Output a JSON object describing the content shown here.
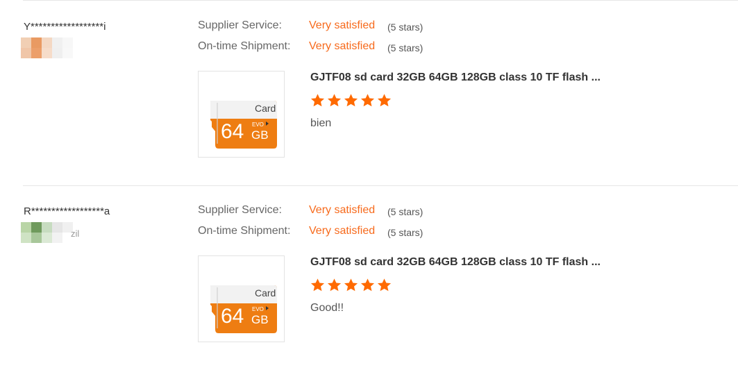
{
  "reviews": [
    {
      "buyer": "Y******************i",
      "country": "",
      "supplier_service_label": "Supplier Service:",
      "supplier_service_value": "Very satisfied",
      "supplier_service_stars": "(5 stars)",
      "shipment_label": "On-time Shipment:",
      "shipment_value": "Very satisfied",
      "shipment_stars": "(5 stars)",
      "product_title": "GJTF08 sd card 32GB 64GB 128GB class 10 TF flash ...",
      "rating": 5,
      "comment": "bien",
      "thumb": {
        "card_text": "Card",
        "capacity": "64",
        "unit": "GB",
        "brand": "EVO"
      }
    },
    {
      "buyer": "R******************a",
      "country": "zil",
      "supplier_service_label": "Supplier Service:",
      "supplier_service_value": "Very satisfied",
      "supplier_service_stars": "(5 stars)",
      "shipment_label": "On-time Shipment:",
      "shipment_value": "Very satisfied",
      "shipment_stars": "(5 stars)",
      "product_title": "GJTF08 sd card 32GB 64GB 128GB class 10 TF flash ...",
      "rating": 5,
      "comment": "Good!!",
      "thumb": {
        "card_text": "Card",
        "capacity": "64",
        "unit": "GB",
        "brand": "EVO"
      }
    }
  ],
  "colors": {
    "accent": "#f76a1c",
    "star": "#ff6a00",
    "card_orange": "#ee7d12"
  }
}
